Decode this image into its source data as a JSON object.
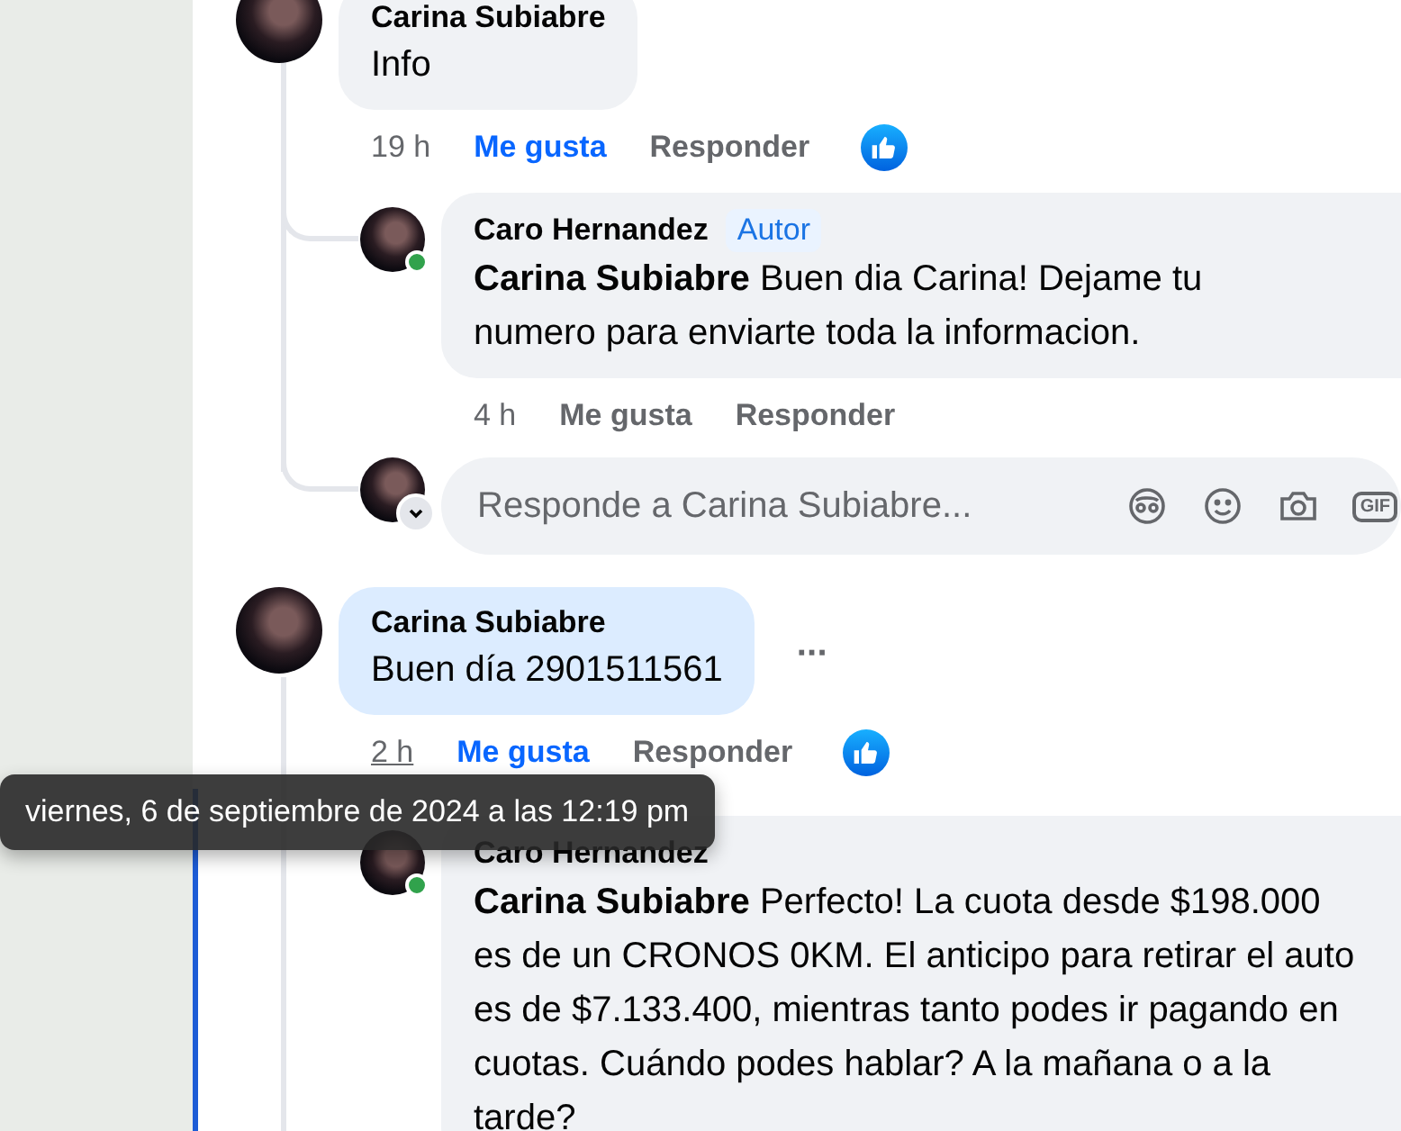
{
  "threads": [
    {
      "comment": {
        "author": "Carina Subiabre",
        "text": "Info",
        "highlighted": false,
        "time": "19 h",
        "time_hovered": false,
        "like_label": "Me gusta",
        "liked": true,
        "reply_label": "Responder",
        "reacted": true
      },
      "replies": [
        {
          "author": "Caro Hernandez",
          "badge": "Autor",
          "mention": "Carina Subiabre",
          "text": "Buen dia Carina! Dejame tu numero para enviarte toda la informacion.",
          "online": true,
          "time": "4 h",
          "like_label": "Me gusta",
          "liked": false,
          "reply_label": "Responder"
        }
      ],
      "composer": {
        "placeholder": "Responde a Carina Subiabre...",
        "gif_label": "GIF"
      }
    },
    {
      "comment": {
        "author": "Carina Subiabre",
        "text": "Buen día 2901511561",
        "highlighted": true,
        "more_label": "···",
        "time": "2 h",
        "time_hovered": true,
        "like_label": "Me gusta",
        "liked": true,
        "reply_label": "Responder",
        "reacted": true
      },
      "replies": [
        {
          "author": "Caro Hernandez",
          "mention": "Carina Subiabre",
          "text": "Perfecto! La cuota desde $198.000 es de un CRONOS 0KM. El anticipo para retirar el auto es de $7.133.400, mientras tanto podes ir pagando en cuotas. Cuándo podes hablar? A la mañana o a la tarde?",
          "online": true
        }
      ]
    }
  ],
  "tooltip": {
    "text": "viernes, 6 de septiembre de 2024 a las 12:19 pm"
  }
}
